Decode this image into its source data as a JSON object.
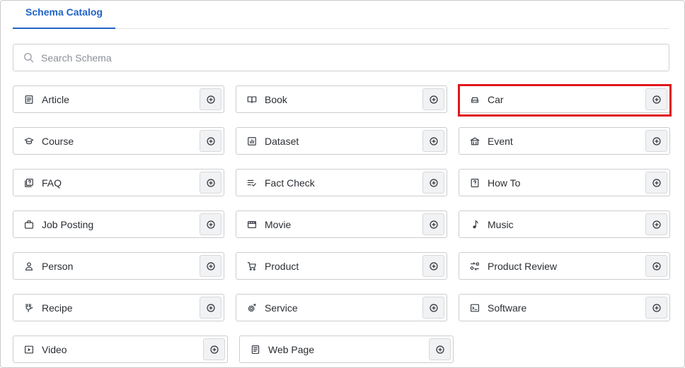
{
  "tabs": [
    {
      "label": "Schema Catalog",
      "active": true
    }
  ],
  "search": {
    "placeholder": "Search Schema",
    "value": ""
  },
  "accent_color": "#2163c8",
  "highlight_color": "#e0171b",
  "schemas": [
    {
      "label": "Article",
      "icon": "article-icon"
    },
    {
      "label": "Book",
      "icon": "book-icon"
    },
    {
      "label": "Car",
      "icon": "car-icon",
      "highlighted": true
    },
    {
      "label": "Course",
      "icon": "graduation-cap-icon"
    },
    {
      "label": "Dataset",
      "icon": "chart-box-icon"
    },
    {
      "label": "Event",
      "icon": "building-icon"
    },
    {
      "label": "FAQ",
      "icon": "faq-icon"
    },
    {
      "label": "Fact Check",
      "icon": "checklist-icon"
    },
    {
      "label": "How To",
      "icon": "question-box-icon"
    },
    {
      "label": "Job Posting",
      "icon": "briefcase-icon"
    },
    {
      "label": "Movie",
      "icon": "film-icon"
    },
    {
      "label": "Music",
      "icon": "music-note-icon"
    },
    {
      "label": "Person",
      "icon": "person-icon"
    },
    {
      "label": "Product",
      "icon": "cart-icon"
    },
    {
      "label": "Product Review",
      "icon": "review-icon"
    },
    {
      "label": "Recipe",
      "icon": "recipe-icon"
    },
    {
      "label": "Service",
      "icon": "service-gear-icon"
    },
    {
      "label": "Software",
      "icon": "terminal-icon"
    },
    {
      "label": "Video",
      "icon": "play-box-icon"
    },
    {
      "label": "Web Page",
      "icon": "document-icon"
    }
  ]
}
